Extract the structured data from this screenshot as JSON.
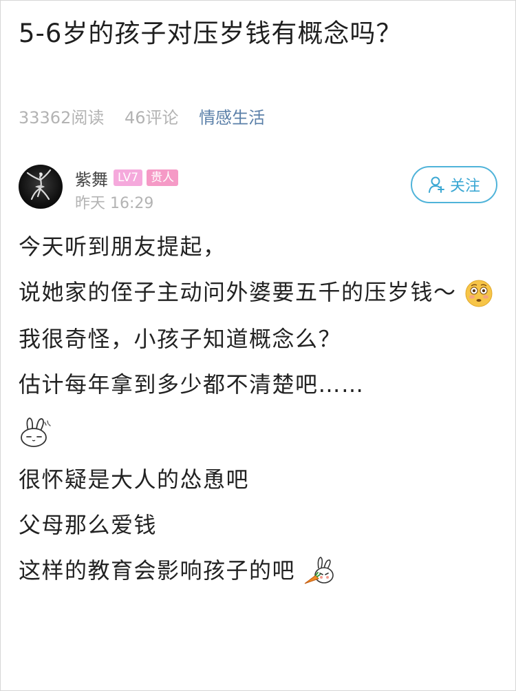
{
  "post": {
    "title": "5-6岁的孩子对压岁钱有概念吗？",
    "meta": {
      "reads": "33362阅读",
      "comments": "46评论",
      "category": "情感生活"
    },
    "author": {
      "name": "紫舞",
      "level_badge": "LV7",
      "role_badge": "贵人",
      "time": "昨天 16:29",
      "avatar_icon": "ballet-dancer-silhouette"
    },
    "follow_label": "关注",
    "colors": {
      "accent": "#3aa7d3",
      "category": "#5a7fa8",
      "badge_pink": "#f5a9dc"
    },
    "body": [
      "今天听到朋友提起，",
      "说她家的侄子主动问外婆要五千的压岁钱～",
      "我很奇怪，小孩子知道概念么？",
      "估计每年拿到多少都不清楚吧……",
      "很怀疑是大人的怂恿吧",
      "父母那么爱钱",
      "这样的教育会影响孩子的吧"
    ],
    "emojis": [
      "flushed-face-emoji",
      "bunny-sweat-sticker",
      "bunny-carrot-sticker"
    ]
  }
}
